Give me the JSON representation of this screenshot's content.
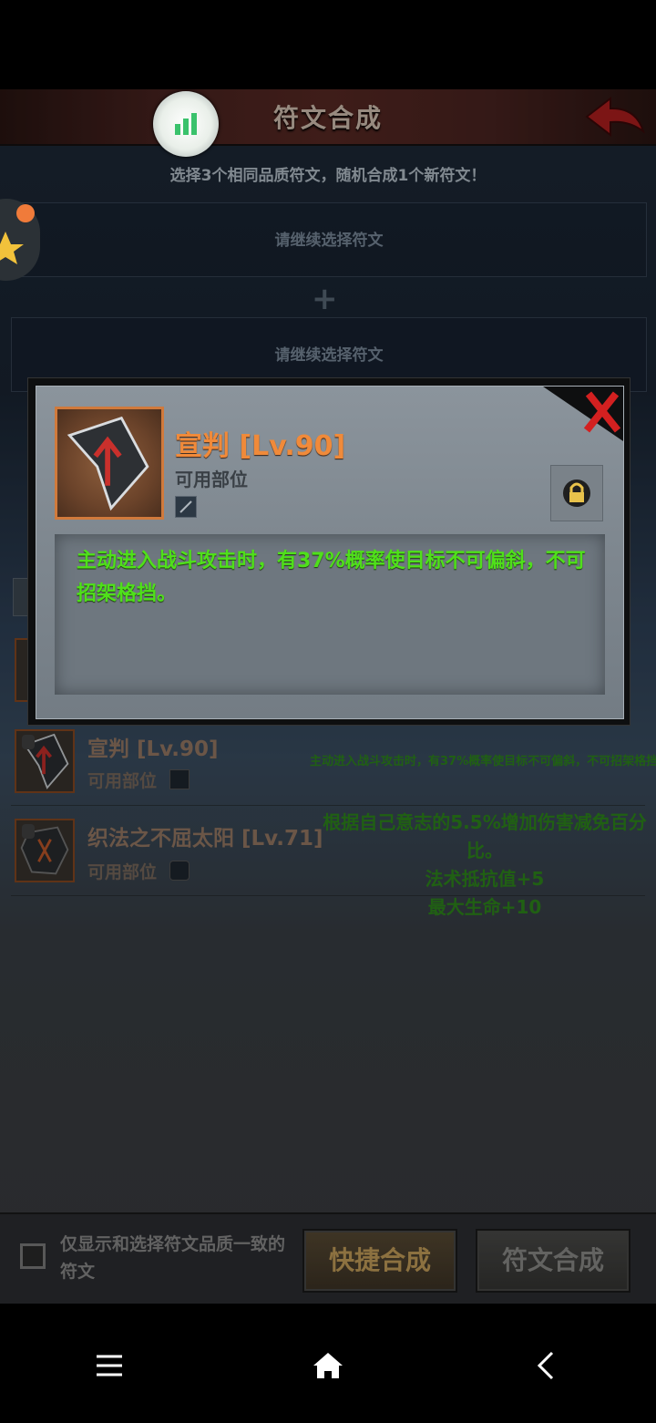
{
  "screen": {
    "title": "符文合成",
    "subtitle": "选择3个相同品质符文，随机合成1个新符文！"
  },
  "slots": [
    {
      "label": "请继续选择符文"
    },
    {
      "label": "请继续选择符文"
    }
  ],
  "plus_symbol": "+",
  "rune_list": [
    {
      "name": "宣判 [Lv.90]",
      "sub_label": "可用部位",
      "description_lines": [
        "主动进入战斗攻击时，有37%概率使目标不可偏斜，不可招架格挡。"
      ],
      "icon": "arrow-rune-icon"
    },
    {
      "name": "织法之不屈太阳 [Lv.71]",
      "sub_label": "可用部位",
      "description_lines": [
        "根据自己意志的5.5%增加伤害减免百分比。",
        "法术抵抗值+5",
        "最大生命+10"
      ],
      "icon": "sun-rune-icon"
    }
  ],
  "bottom_bar": {
    "filter_label": "仅显示和选择符文品质一致的符文",
    "filter_checked": false,
    "quick_button": "快捷合成",
    "rune_button": "符文合成"
  },
  "dialog": {
    "name": "宣判 [Lv.90]",
    "sub_label": "可用部位",
    "description": "主动进入战斗攻击时，有37%概率使目标不可偏斜，不可招架格挡。",
    "icon": "arrow-rune-icon",
    "lock_icon": "padlock-icon",
    "close_icon": "red-x-icon"
  },
  "nav": {
    "menu_icon": "menu-icon",
    "home_icon": "home-icon",
    "back_icon": "back-chevron-icon"
  },
  "colors": {
    "rune_name_orange": "#f08a3a",
    "description_green": "#4fe01a",
    "list_green": "#2f8a1c"
  }
}
